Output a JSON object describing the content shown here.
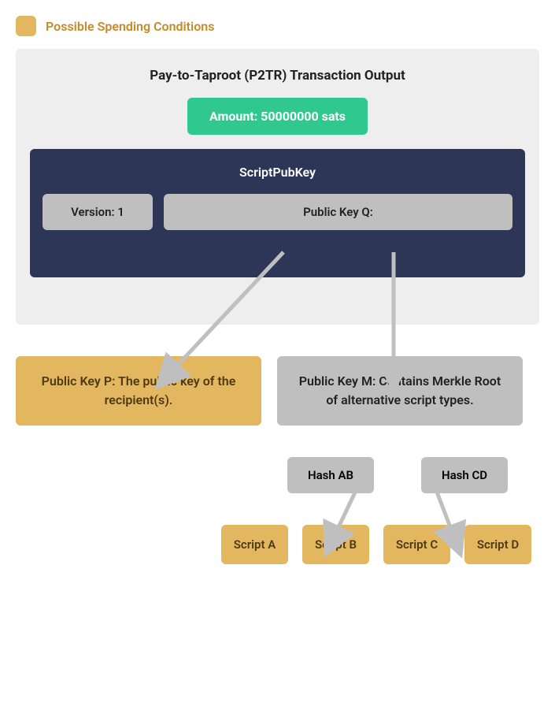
{
  "legend": {
    "label": "Possible Spending Conditions"
  },
  "panel": {
    "title": "Pay-to-Taproot (P2TR) Transaction Output",
    "amount": "Amount: 50000000 sats",
    "spk": {
      "title": "ScriptPubKey",
      "version": "Version: 1",
      "q": "Public Key Q:"
    }
  },
  "public_key_p": "Public Key P: The public key of the recipient(s).",
  "public_key_m": "Public Key M: Contains Merkle Root of alternative script types.",
  "hash_ab": "Hash AB",
  "hash_cd": "Hash CD",
  "scripts": [
    "Script A",
    "Script B",
    "Script C",
    "Script D"
  ],
  "colors": {
    "gold": "#e3b75f",
    "panel_gray": "#eeeeee",
    "box_gray": "#bfbfbf",
    "navy": "#2e3658",
    "green": "#2fc98f",
    "arrow": "#bfbfbf"
  }
}
